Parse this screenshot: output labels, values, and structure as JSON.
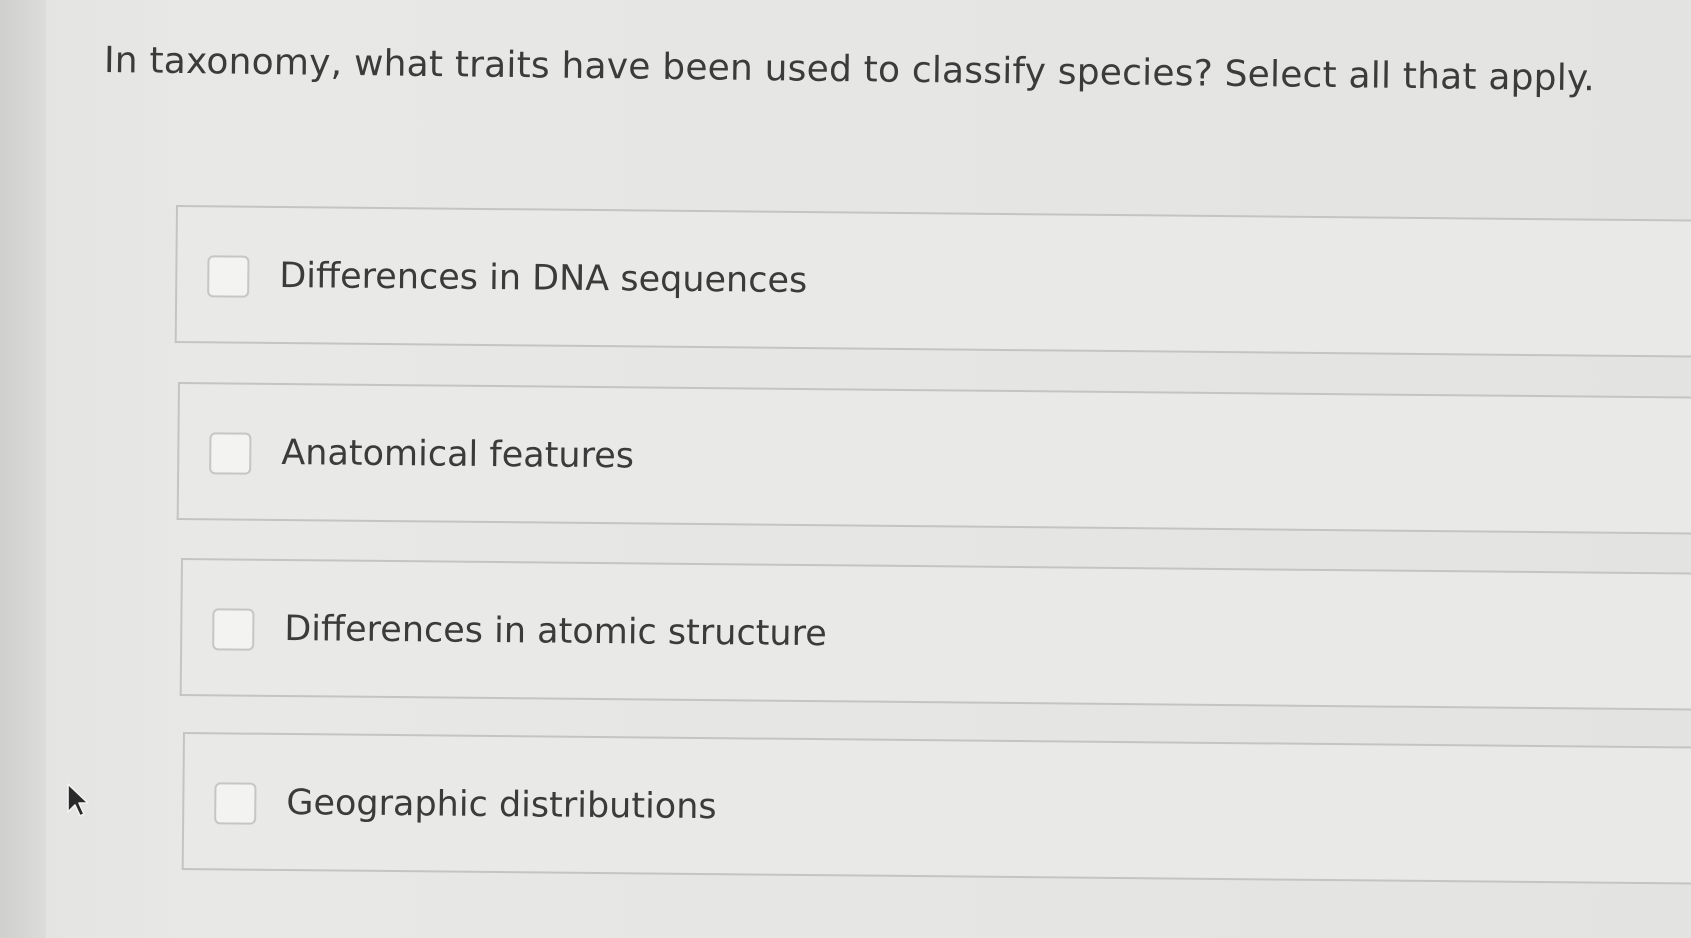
{
  "question": {
    "text": "In taxonomy, what traits have been used to classify species? Select all that apply."
  },
  "options": [
    {
      "label": "Differences in DNA sequences",
      "checked": false
    },
    {
      "label": "Anatomical features",
      "checked": false
    },
    {
      "label": "Differences in atomic structure",
      "checked": false
    },
    {
      "label": "Geographic distributions",
      "checked": false
    }
  ],
  "colors": {
    "background": "#e6e6e4",
    "option_border": "#c4c4c2",
    "checkbox_border": "#c6c6c4",
    "text": "#3b3b3b"
  },
  "icons": {
    "cursor": "mouse-pointer-icon"
  }
}
